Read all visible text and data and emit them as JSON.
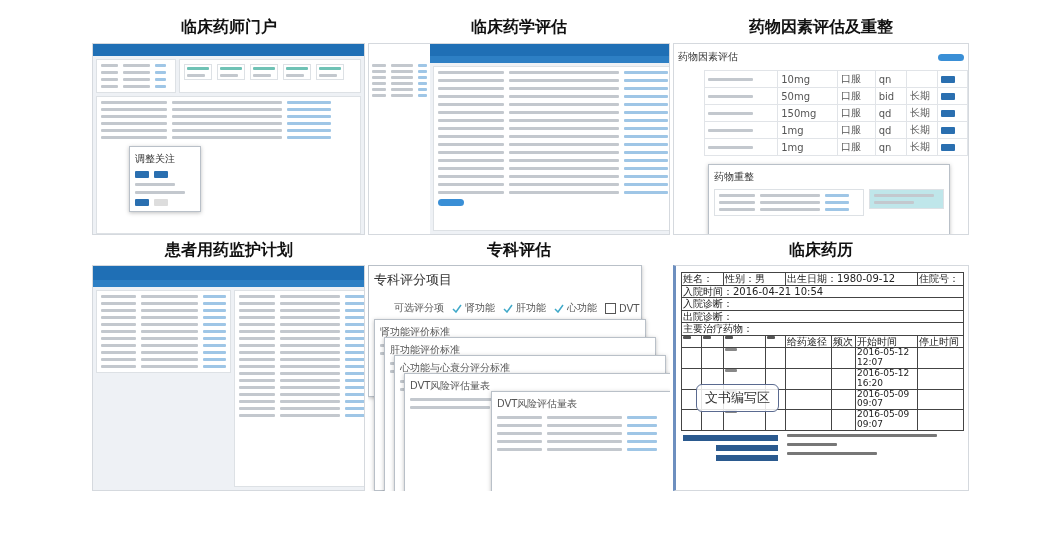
{
  "panels": [
    {
      "kind": "portal",
      "title": "临床药师门户",
      "popup": {
        "title": "调整关注"
      }
    },
    {
      "kind": "form",
      "title": "临床药学评估"
    },
    {
      "kind": "drug_table",
      "title": "药物因素评估及重整",
      "header": "药物因素评估",
      "rows": [
        {
          "dose": "10mg",
          "route": "口服",
          "freq": "qn",
          "term": ""
        },
        {
          "dose": "50mg",
          "route": "口服",
          "freq": "bid",
          "term": "长期"
        },
        {
          "dose": "150mg",
          "route": "口服",
          "freq": "qd",
          "term": "长期"
        },
        {
          "dose": "1mg",
          "route": "口服",
          "freq": "qd",
          "term": "长期"
        },
        {
          "dose": "1mg",
          "route": "口服",
          "freq": "qn",
          "term": "长期"
        }
      ],
      "dialog": {
        "title": "药物重整"
      }
    },
    {
      "kind": "plan",
      "title": "患者用药监护计划"
    },
    {
      "kind": "scoring",
      "title": "专科评估",
      "dialog_title": "专科评分项目",
      "options_label": "可选评分项",
      "options": [
        {
          "label": "肾功能",
          "checked": true
        },
        {
          "label": "肝功能",
          "checked": true
        },
        {
          "label": "心功能",
          "checked": true
        },
        {
          "label": "DVT",
          "checked": false
        }
      ],
      "stacked": [
        "肾功能评价标准",
        "肝功能评价标准",
        "心功能与心衰分评分标准",
        "DVT风险评估量表"
      ],
      "front_title": "DVT风险评估量表"
    },
    {
      "kind": "record",
      "title": "临床药历",
      "fields": [
        "姓名：",
        "性别：男",
        "出生日期：1980-09-12",
        "住院号：",
        "入院时间：2016-04-21 10:54",
        "入院诊断：",
        "出院诊断：",
        "主要治疗药物："
      ],
      "columns": [
        "给药途径",
        "频次",
        "开始时间",
        "停止时间"
      ],
      "rows": [
        {
          "time": "2016-05-12 12:07"
        },
        {
          "time": "2016-05-12 16:20"
        },
        {
          "time": "2016-05-09 09:07"
        },
        {
          "time": "2016-05-09 09:07"
        }
      ],
      "callout": "文书编写区"
    }
  ]
}
